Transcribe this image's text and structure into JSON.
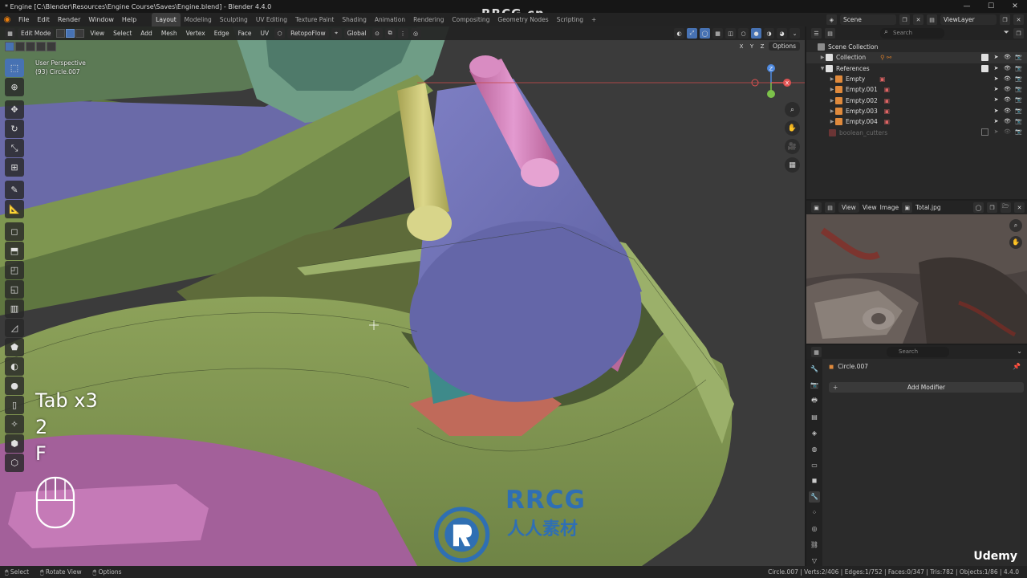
{
  "window": {
    "title": "* Engine [C:\\Blender\\Resources\\Engine Course\\Saves\\Engine.blend] - Blender 4.4.0",
    "controls": [
      "—",
      "☐",
      "✕"
    ]
  },
  "menu": {
    "items": [
      "File",
      "Edit",
      "Render",
      "Window",
      "Help"
    ],
    "workspaces": [
      "Layout",
      "Modeling",
      "Sculpting",
      "UV Editing",
      "Texture Paint",
      "Shading",
      "Animation",
      "Rendering",
      "Compositing",
      "Geometry Nodes",
      "Scripting"
    ],
    "active_workspace": "Layout",
    "scene": "Scene",
    "view_layer": "ViewLayer"
  },
  "viewport": {
    "mode": "Edit Mode",
    "menus": [
      "View",
      "Select",
      "Add",
      "Mesh",
      "Vertex",
      "Edge",
      "Face",
      "UV"
    ],
    "addon": "RetopoFlow",
    "orientation": "Global",
    "axes": [
      "X",
      "Y",
      "Z"
    ],
    "options": "Options",
    "overlay_line1": "User Perspective",
    "overlay_line2": "(93) Circle.007",
    "keys": [
      "Tab x3",
      "2",
      "F"
    ],
    "gizmo_z": "Z",
    "gizmo_x": "X",
    "accent": "#4772b3"
  },
  "outliner": {
    "search_placeholder": "Search",
    "rows": [
      {
        "label": "Scene Collection",
        "color": "#dddddd"
      },
      {
        "label": "Collection",
        "color": "#e0e0e0"
      },
      {
        "label": "References",
        "color": "#e0e0e0"
      },
      {
        "label": "Empty",
        "color": "#e08a3c"
      },
      {
        "label": "Empty.001",
        "color": "#e08a3c"
      },
      {
        "label": "Empty.002",
        "color": "#e08a3c"
      },
      {
        "label": "Empty.003",
        "color": "#e08a3c"
      },
      {
        "label": "Empty.004",
        "color": "#e08a3c"
      },
      {
        "label": "boolean_cutters",
        "color": "#8a3c3c"
      }
    ]
  },
  "image_editor": {
    "menus": [
      "View",
      "View",
      "Image"
    ],
    "image_name": "Total.jpg"
  },
  "properties": {
    "search_placeholder": "Search",
    "object_name": "Circle.007",
    "add_modifier": "Add Modifier"
  },
  "status": {
    "select": "Select",
    "rotate": "Rotate View",
    "options": "Options",
    "stats": "Circle.007 | Verts:2/406 | Edges:1/752 | Faces:0/347 | Tris:782 | Objects:1/86 | 4.4.0",
    "udemy": "Udemy"
  },
  "watermark": {
    "brand": "RRCG",
    "sub": "人人素材",
    "top": "RRCG.cn"
  }
}
